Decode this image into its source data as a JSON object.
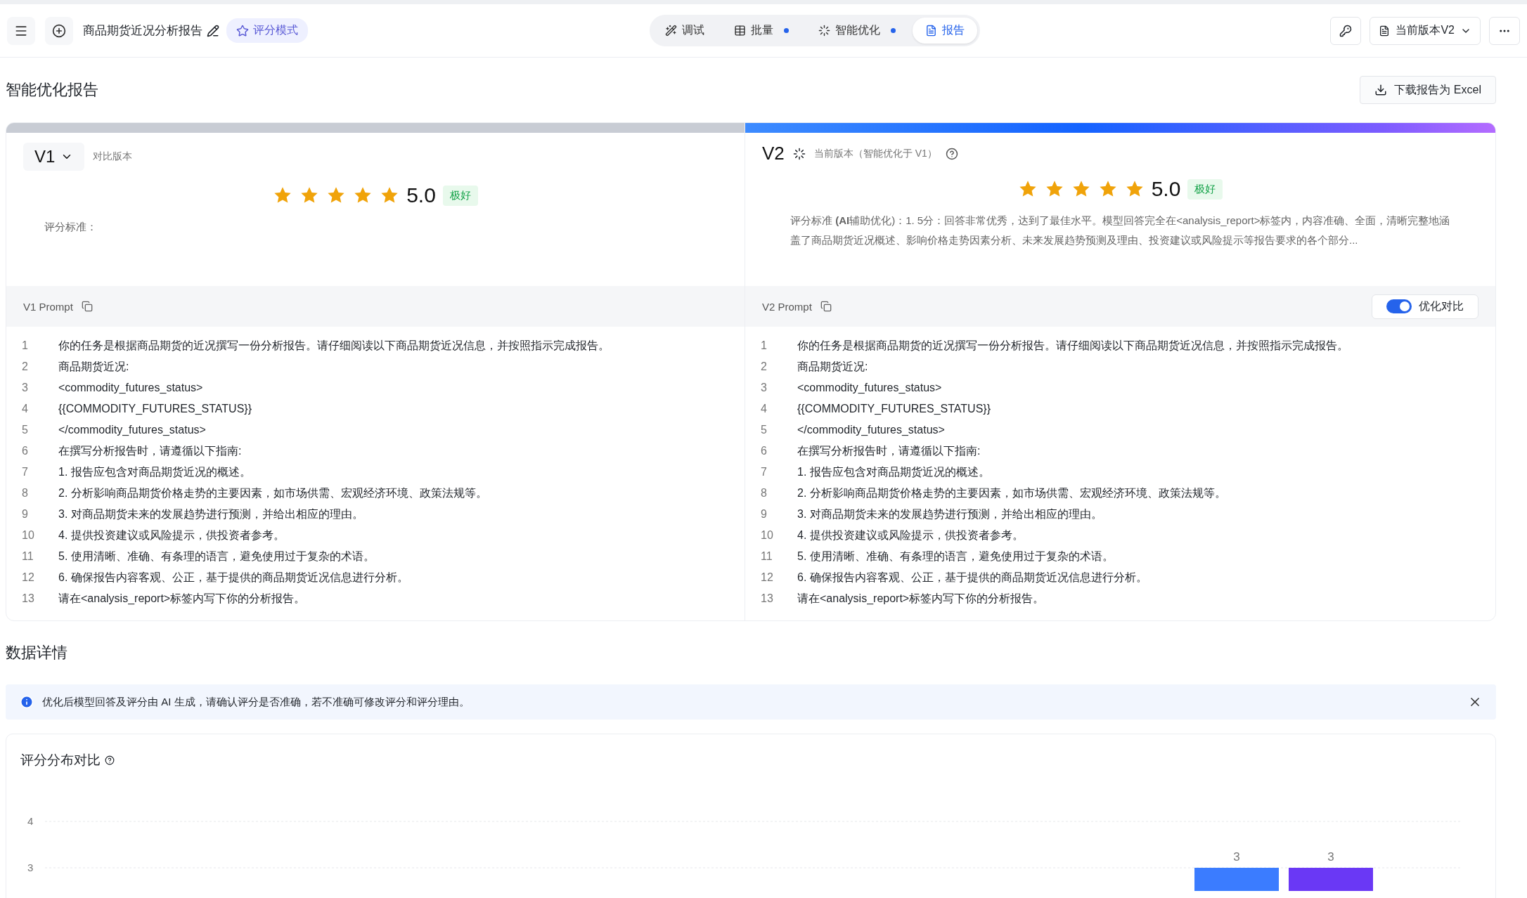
{
  "toolbar": {
    "title": "商品期货近况分析报告",
    "mode_badge": "评分模式",
    "tabs": [
      {
        "label": "调试",
        "selected": false,
        "dot": false
      },
      {
        "label": "批量",
        "selected": false,
        "dot": true
      },
      {
        "label": "智能优化",
        "selected": false,
        "dot": true
      },
      {
        "label": "报告",
        "selected": true,
        "dot": false
      }
    ],
    "version_select": "当前版本V2"
  },
  "report": {
    "title": "智能优化报告",
    "download_button": "下载报告为 Excel",
    "panels": [
      {
        "kind": "compare",
        "version": "V1",
        "subtitle": "对比版本",
        "stars": 5,
        "score": "5.0",
        "grade": "极好",
        "criteria": "评分标准：",
        "prompt_label": "V1 Prompt",
        "lines": [
          {
            "no": "1",
            "text": "你的任务是根据商品期货的近况撰写一份分析报告。请仔细阅读以下商品期货近况信息，并按照指示完成报告。"
          },
          {
            "no": "2",
            "text": "商品期货近况:"
          },
          {
            "no": "3",
            "text": "<commodity_futures_status>"
          },
          {
            "no": "4",
            "text": "{{COMMODITY_FUTURES_STATUS}}"
          },
          {
            "no": "5",
            "text": "</commodity_futures_status>"
          },
          {
            "no": "6",
            "text": "在撰写分析报告时，请遵循以下指南:"
          },
          {
            "no": "7",
            "text": "1. 报告应包含对商品期货近况的概述。"
          },
          {
            "no": "8",
            "text": "2. 分析影响商品期货价格走势的主要因素，如市场供需、宏观经济环境、政策法规等。"
          },
          {
            "no": "9",
            "text": "3. 对商品期货未来的发展趋势进行预测，并给出相应的理由。"
          },
          {
            "no": "10",
            "text": "4. 提供投资建议或风险提示，供投资者参考。"
          },
          {
            "no": "11",
            "text": "5. 使用清晰、准确、有条理的语言，避免使用过于复杂的术语。"
          },
          {
            "no": "12",
            "text": "6. 确保报告内容客观、公正，基于提供的商品期货近况信息进行分析。"
          },
          {
            "no": "13",
            "text": "请在<analysis_report>标签内写下你的分析报告。"
          }
        ]
      },
      {
        "kind": "current",
        "version": "V2",
        "subtitle": "当前版本（智能优化于 V1）",
        "stars": 5,
        "score": "5.0",
        "grade": "极好",
        "criteria": "评分标准 **(AI**辅助优化)：1. 5分：回答非常优秀，达到了最佳水平。模型回答完全在<analysis_report>标签内，内容准确、全面，清晰完整地涵盖了商品期货近况概述、影响价格走势因素分析、未来发展趋势预测及理由、投资建议或风险提示等报告要求的各个部分...",
        "prompt_label": "V2 Prompt",
        "toggle": {
          "label": "优化对比",
          "on": true
        },
        "lines": [
          {
            "no": "1",
            "text": "你的任务是根据商品期货的近况撰写一份分析报告。请仔细阅读以下商品期货近况信息，并按照指示完成报告。"
          },
          {
            "no": "2",
            "text": "商品期货近况:"
          },
          {
            "no": "3",
            "text": "<commodity_futures_status>"
          },
          {
            "no": "4",
            "text": "{{COMMODITY_FUTURES_STATUS}}"
          },
          {
            "no": "5",
            "text": "</commodity_futures_status>"
          },
          {
            "no": "6",
            "text": "在撰写分析报告时，请遵循以下指南:"
          },
          {
            "no": "7",
            "text": "1. 报告应包含对商品期货近况的概述。"
          },
          {
            "no": "8",
            "text": "2. 分析影响商品期货价格走势的主要因素，如市场供需、宏观经济环境、政策法规等。"
          },
          {
            "no": "9",
            "text": "3. 对商品期货未来的发展趋势进行预测，并给出相应的理由。"
          },
          {
            "no": "10",
            "text": "4. 提供投资建议或风险提示，供投资者参考。"
          },
          {
            "no": "11",
            "text": "5. 使用清晰、准确、有条理的语言，避免使用过于复杂的术语。"
          },
          {
            "no": "12",
            "text": "6. 确保报告内容客观、公正，基于提供的商品期货近况信息进行分析。"
          },
          {
            "no": "13",
            "text": "请在<analysis_report>标签内写下你的分析报告。"
          }
        ]
      }
    ]
  },
  "details": {
    "title": "数据详情",
    "notice": "优化后模型回答及评分由 AI 生成，请确认评分是否准确，若不准确可修改评分和评分理由。",
    "chart_card": {
      "title": "评分分布对比",
      "chart_data": {
        "type": "bar",
        "ylim": [
          2.5,
          4
        ],
        "yticks": [
          3,
          4
        ],
        "data_labels": true,
        "series": [
          {
            "color": "#3b7cff",
            "values": [
              3
            ]
          },
          {
            "color": "#6a38f5",
            "values": [
              3
            ]
          }
        ]
      }
    }
  }
}
